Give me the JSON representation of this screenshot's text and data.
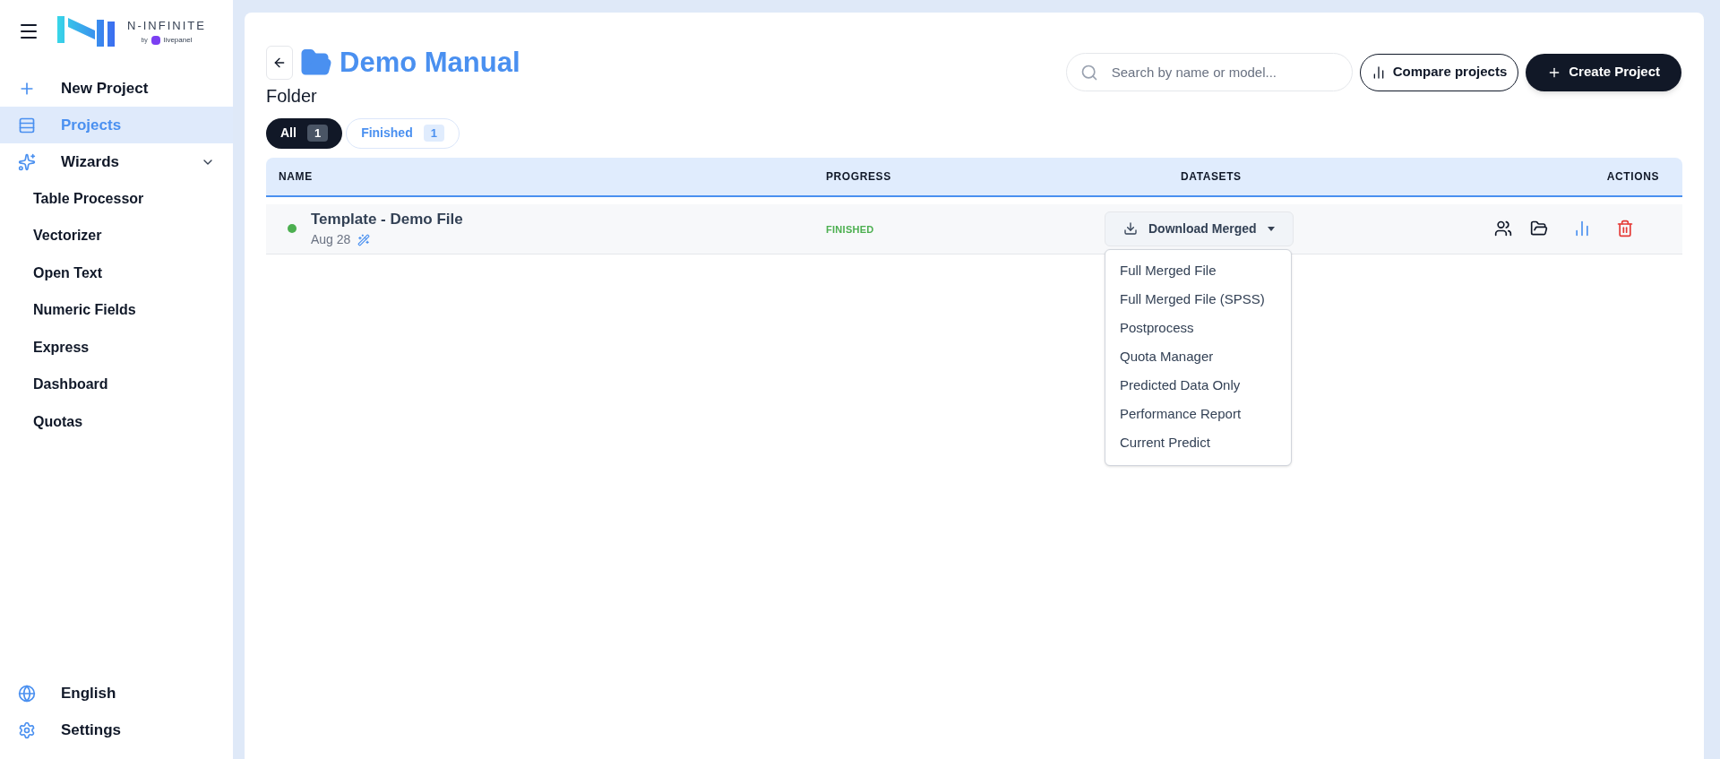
{
  "sidebar": {
    "brand": {
      "name": "N-INFINITE",
      "by": "by",
      "partner": "livepanel"
    },
    "nav": [
      {
        "label": "New Project",
        "selected": false
      },
      {
        "label": "Projects",
        "selected": true
      },
      {
        "label": "Wizards",
        "selected": false,
        "expanded": true,
        "children": [
          {
            "label": "Table Processor"
          },
          {
            "label": "Vectorizer"
          },
          {
            "label": "Open Text"
          },
          {
            "label": "Numeric Fields"
          },
          {
            "label": "Express"
          },
          {
            "label": "Dashboard"
          },
          {
            "label": "Quotas"
          }
        ]
      }
    ],
    "footer": [
      {
        "label": "English"
      },
      {
        "label": "Settings"
      }
    ]
  },
  "header": {
    "title": "Demo Manual",
    "subtitle": "Folder",
    "search": {
      "placeholder": "Search by name or model..."
    },
    "buttons": [
      {
        "label": "Compare projects",
        "kind": "outline"
      },
      {
        "label": "Create Project",
        "kind": "primary"
      }
    ]
  },
  "tabs": [
    {
      "label": "All",
      "count": "1",
      "selected": true
    },
    {
      "label": "Finished",
      "count": "1",
      "selected": false
    }
  ],
  "table": {
    "columns": [
      "NAME",
      "PROGRESS",
      "DATASETS",
      "ACTIONS"
    ],
    "rows": [
      {
        "name": "Template - Demo File",
        "date": "Aug 28",
        "color": "#4caf50",
        "progress": "FINISHED",
        "dataset_button": "Download Merged",
        "menu_open": true,
        "menu": [
          "Full Merged File",
          "Full Merged File (SPSS)",
          "Postprocess",
          "Quota Manager",
          "Predicted Data Only",
          "Performance Report",
          "Current Predict"
        ]
      }
    ]
  }
}
